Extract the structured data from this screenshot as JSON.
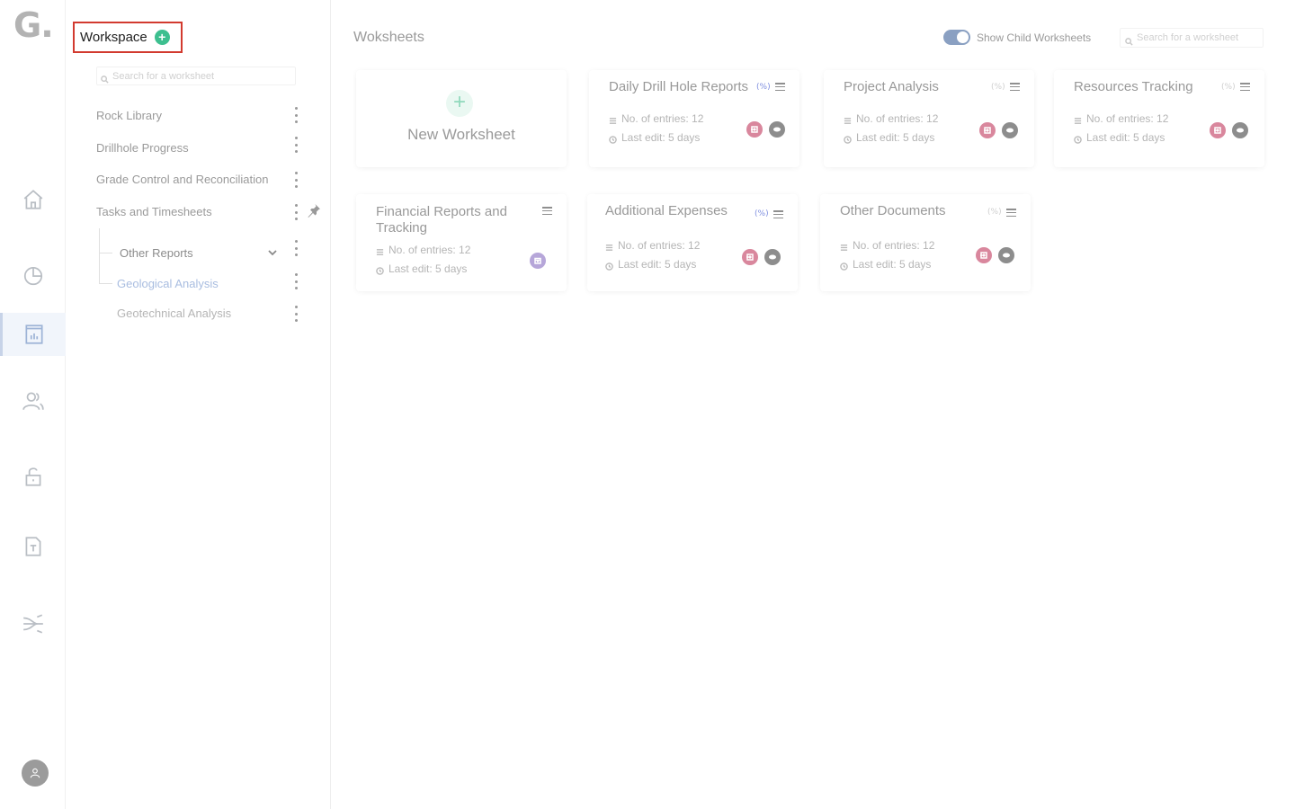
{
  "app": {
    "logo": "G",
    "logo_dot": "."
  },
  "rail": {
    "items": [
      {
        "icon": "home-icon"
      },
      {
        "icon": "pie-chart-icon"
      },
      {
        "icon": "worksheet-icon",
        "active": true
      },
      {
        "icon": "users-icon"
      },
      {
        "icon": "unlock-icon"
      },
      {
        "icon": "document-icon"
      },
      {
        "icon": "flow-icon"
      }
    ],
    "avatar_icon": "user-icon"
  },
  "workspace": {
    "title": "Workspace",
    "add_icon": "+",
    "search_placeholder": "Search for a worksheet",
    "items": [
      {
        "label": "Rock Library"
      },
      {
        "label": "Drillhole Progress"
      },
      {
        "label": "Grade Control and Reconciliation"
      },
      {
        "label": "Tasks and Timesheets",
        "pinned": true
      },
      {
        "label": "Other Reports",
        "expanded": true
      },
      {
        "label": "Geological Analysis",
        "selected": true
      },
      {
        "label": "Geotechnical Analysis"
      }
    ]
  },
  "main": {
    "title": "Woksheets",
    "toggle": {
      "label": "Show Child Worksheets",
      "on": true
    },
    "search_placeholder": "Search for a worksheet",
    "new_card": {
      "plus": "+",
      "label": "New Worksheet"
    },
    "cards": [
      {
        "title": "Daily Drill Hole Reports",
        "entries": "No. of entries: 12",
        "last_edit": "Last edit: 5 days",
        "linked": true
      },
      {
        "title": "Project Analysis",
        "entries": "No. of entries: 12",
        "last_edit": "Last edit: 5 days",
        "linked": false
      },
      {
        "title": "Resources Tracking",
        "entries": "No. of entries: 12",
        "last_edit": "Last edit: 5 days",
        "linked": false
      },
      {
        "title": "Financial Reports and Tracking",
        "entries": "No. of entries: 12",
        "last_edit": "Last edit: 5 days"
      },
      {
        "title": "Additional Expenses",
        "entries": "No. of entries: 12",
        "last_edit": "Last edit: 5 days",
        "linked": true
      },
      {
        "title": "Other Documents",
        "entries": "No. of entries: 12",
        "last_edit": "Last edit: 5 days",
        "linked": false
      }
    ],
    "link_glyph": "(%)"
  }
}
